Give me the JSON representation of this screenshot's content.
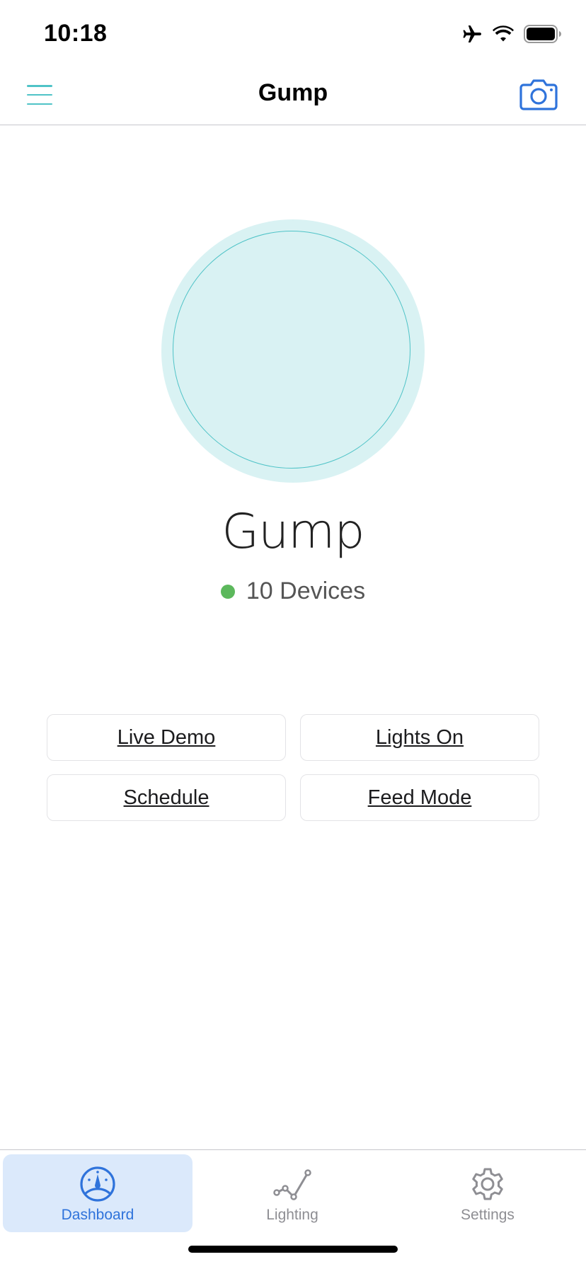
{
  "status_bar": {
    "time": "10:18",
    "icons": [
      "airplane-icon",
      "wifi-icon",
      "battery-icon"
    ]
  },
  "nav": {
    "title": "Gump",
    "left_icon": "menu-icon",
    "right_icon": "camera-icon"
  },
  "profile": {
    "name": "Gump",
    "device_count": "10 Devices",
    "status_color": "#5cb85c"
  },
  "actions": [
    {
      "label": "Live Demo"
    },
    {
      "label": "Lights On"
    },
    {
      "label": "Schedule"
    },
    {
      "label": "Feed Mode"
    }
  ],
  "tabs": [
    {
      "label": "Dashboard",
      "icon": "dashboard-gauge-icon",
      "active": true
    },
    {
      "label": "Lighting",
      "icon": "line-chart-icon",
      "active": false
    },
    {
      "label": "Settings",
      "icon": "gear-icon",
      "active": false
    }
  ],
  "colors": {
    "accent_teal": "#4fc3c7",
    "accent_blue": "#2f73db",
    "avatar_fill": "#d9f2f3",
    "active_tab_bg": "#dbe9fb"
  }
}
